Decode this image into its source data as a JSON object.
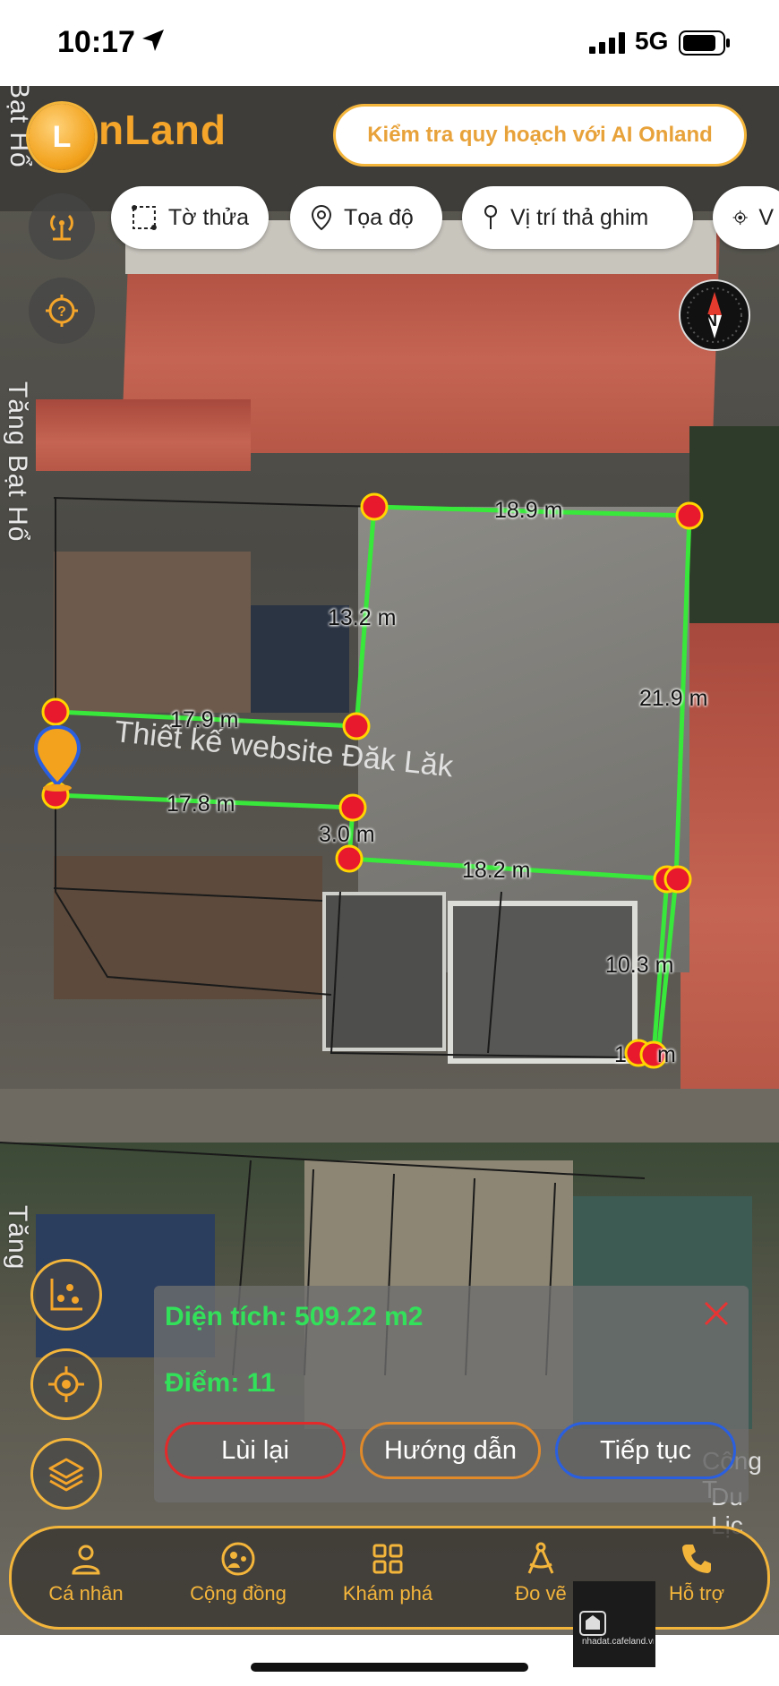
{
  "status_bar": {
    "time": "10:17",
    "network": "5G"
  },
  "app": {
    "brand": "nLand",
    "ai_button_label": "Kiểm tra quy hoạch với AI Onland"
  },
  "filter_chips": [
    {
      "label": "Tờ thửa",
      "icon": "parcel-icon"
    },
    {
      "label": "Tọa độ",
      "icon": "location-pin-icon"
    },
    {
      "label": "Vị trí thả ghim",
      "icon": "drop-pin-icon"
    },
    {
      "label": "V",
      "icon": "crosshair-icon"
    }
  ],
  "map": {
    "road_labels": [
      "Bạt Hổ",
      "Tăng Bạt Hổ",
      "Tăng"
    ],
    "watermark": "Thiết kế website Đăk Lăk",
    "compass_label": "N",
    "measurements": [
      "18.9 m",
      "13.2 m",
      "21.9 m",
      "17.9 m",
      "17.8 m",
      "3.0 m",
      "18.2 m",
      "10.3 m",
      "1",
      "m"
    ],
    "bottom_right_text": [
      "Công T",
      "Du Lịc"
    ]
  },
  "measure_panel": {
    "area_text": "Diện tích: 509.22 m2",
    "points_text": "Điểm: 11",
    "back_label": "Lùi lại",
    "guide_label": "Hướng dẫn",
    "continue_label": "Tiếp tục",
    "colors": {
      "text": "#33e05a",
      "back": "#e32a2a",
      "guide": "#e08a2a",
      "continue": "#2a5fe0"
    }
  },
  "bottom_nav": [
    {
      "label": "Cá nhân",
      "icon": "person-icon"
    },
    {
      "label": "Cộng đồng",
      "icon": "community-icon"
    },
    {
      "label": "Khám phá",
      "icon": "grid-icon"
    },
    {
      "label": "Đo vẽ",
      "icon": "measure-icon"
    },
    {
      "label": "Hỗ trợ",
      "icon": "phone-icon"
    }
  ],
  "watermark_logo": {
    "text": "nhadat.cafeland.vn"
  },
  "accent_color": "#f4b53b"
}
